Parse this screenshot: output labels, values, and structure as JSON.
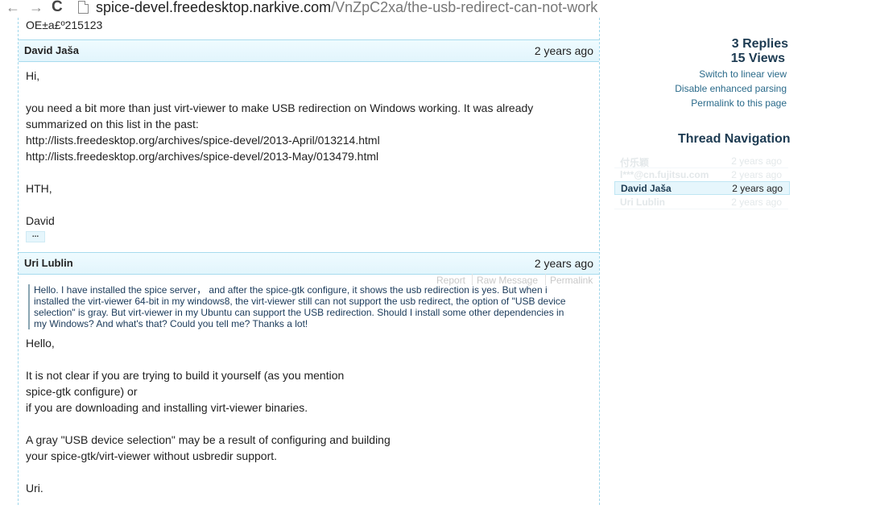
{
  "browser": {
    "back_icon": "←",
    "forward_icon": "→",
    "reload_icon": "C",
    "url_host": "spice-devel.freedesktop.narkive.com",
    "url_path": "/VnZpC2xa/the-usb-redirect-can-not-work"
  },
  "thread": {
    "cut_text": "OE±a£º215123",
    "messages": [
      {
        "author": "David Jaša",
        "date": "2 years ago",
        "lines": [
          "Hi,",
          "",
          "you need a bit more than just virt-viewer to make USB redirection on Windows working. It was already",
          "summarized on this list in the past:",
          "http://lists.freedesktop.org/archives/spice-devel/2013-April/013214.html",
          "http://lists.freedesktop.org/archives/spice-devel/2013-May/013479.html",
          "",
          "HTH,",
          "",
          "David"
        ],
        "ellipsis": "..."
      },
      {
        "author": "Uri Lublin",
        "date": "2 years ago",
        "actions": [
          "Report",
          "Raw Message",
          "Permalink"
        ],
        "quote": "Hello. I have installed the spice server，  and after the spice-gtk configure, it shows the usb redirection is yes. But when i installed the virt-viewer 64-bit in my windows8, the virt-viewer still can not support the usb redirect, the option of \"USB device selection\" is gray. But virt-viewer in my Ubuntu can support the USB redirection. Should I install some other dependencies in my Windows? And what's that? Could you tell me? Thanks a lot!",
        "lines": [
          "Hello,",
          "",
          "It is not clear if you are trying to build it yourself (as you mention",
          "spice-gtk configure) or",
          "if you are downloading and installing virt-viewer binaries.",
          "",
          "A gray \"USB device selection\" may be a result of configuring and building",
          "your spice-gtk/virt-viewer without usbredir support.",
          "",
          "Uri."
        ]
      }
    ]
  },
  "sidebar": {
    "replies": "3 Replies",
    "views": "15 Views",
    "links": [
      "Switch to linear view",
      "Disable enhanced parsing",
      "Permalink to this page"
    ],
    "nav_title": "Thread Navigation",
    "nav": [
      {
        "name": "付乐颖",
        "date": "2 years ago"
      },
      {
        "name": "l***@cn.fujitsu.com",
        "date": "2 years ago"
      },
      {
        "name": "David Jaša",
        "date": "2 years ago"
      },
      {
        "name": "Uri Lublin",
        "date": "2 years ago"
      }
    ]
  }
}
